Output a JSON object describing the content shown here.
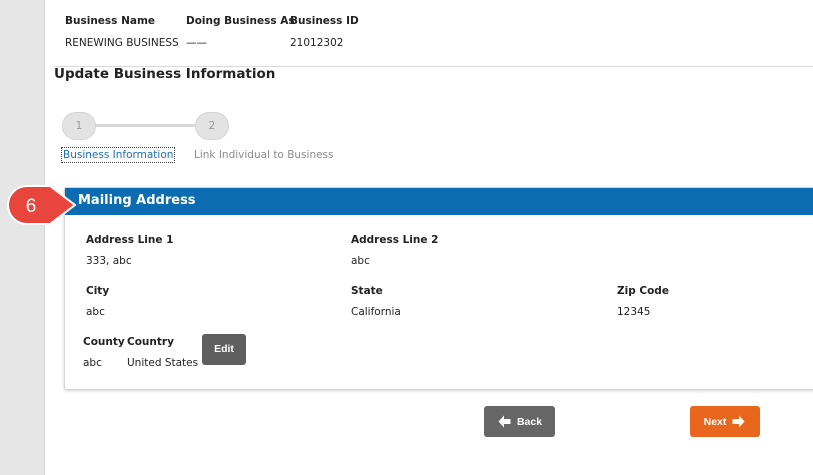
{
  "summary": {
    "business_name_label": "Business Name",
    "business_name_value": "RENEWING BUSINESS",
    "dba_label": "Doing Business As",
    "dba_value": "——",
    "business_id_label": "Business ID",
    "business_id_value": "21012302"
  },
  "page_title": "Update Business Information",
  "steps": [
    {
      "number": "1",
      "label": "Business Information",
      "active": true
    },
    {
      "number": "2",
      "label": "Link Individual to Business",
      "active": false
    }
  ],
  "callout": {
    "number": "6",
    "color": "#e8453c"
  },
  "mailing_address": {
    "title": "Mailing Address",
    "header_color": "#0b6cb2",
    "address_line_1_label": "Address Line 1",
    "address_line_1_value": "333, abc",
    "address_line_2_label": "Address Line 2",
    "address_line_2_value": "abc",
    "city_label": "City",
    "city_value": "abc",
    "state_label": "State",
    "state_value": "California",
    "zip_label": "Zip Code",
    "zip_value": "12345",
    "county_label": "County",
    "county_value": "abc",
    "country_label": "Country",
    "country_value": "United States",
    "edit_label": "Edit"
  },
  "nav": {
    "back_label": "Back",
    "back_icon": "arrow-left-icon",
    "next_label": "Next",
    "next_icon": "arrow-right-icon",
    "next_color": "#e8671c",
    "back_color": "#666666"
  }
}
